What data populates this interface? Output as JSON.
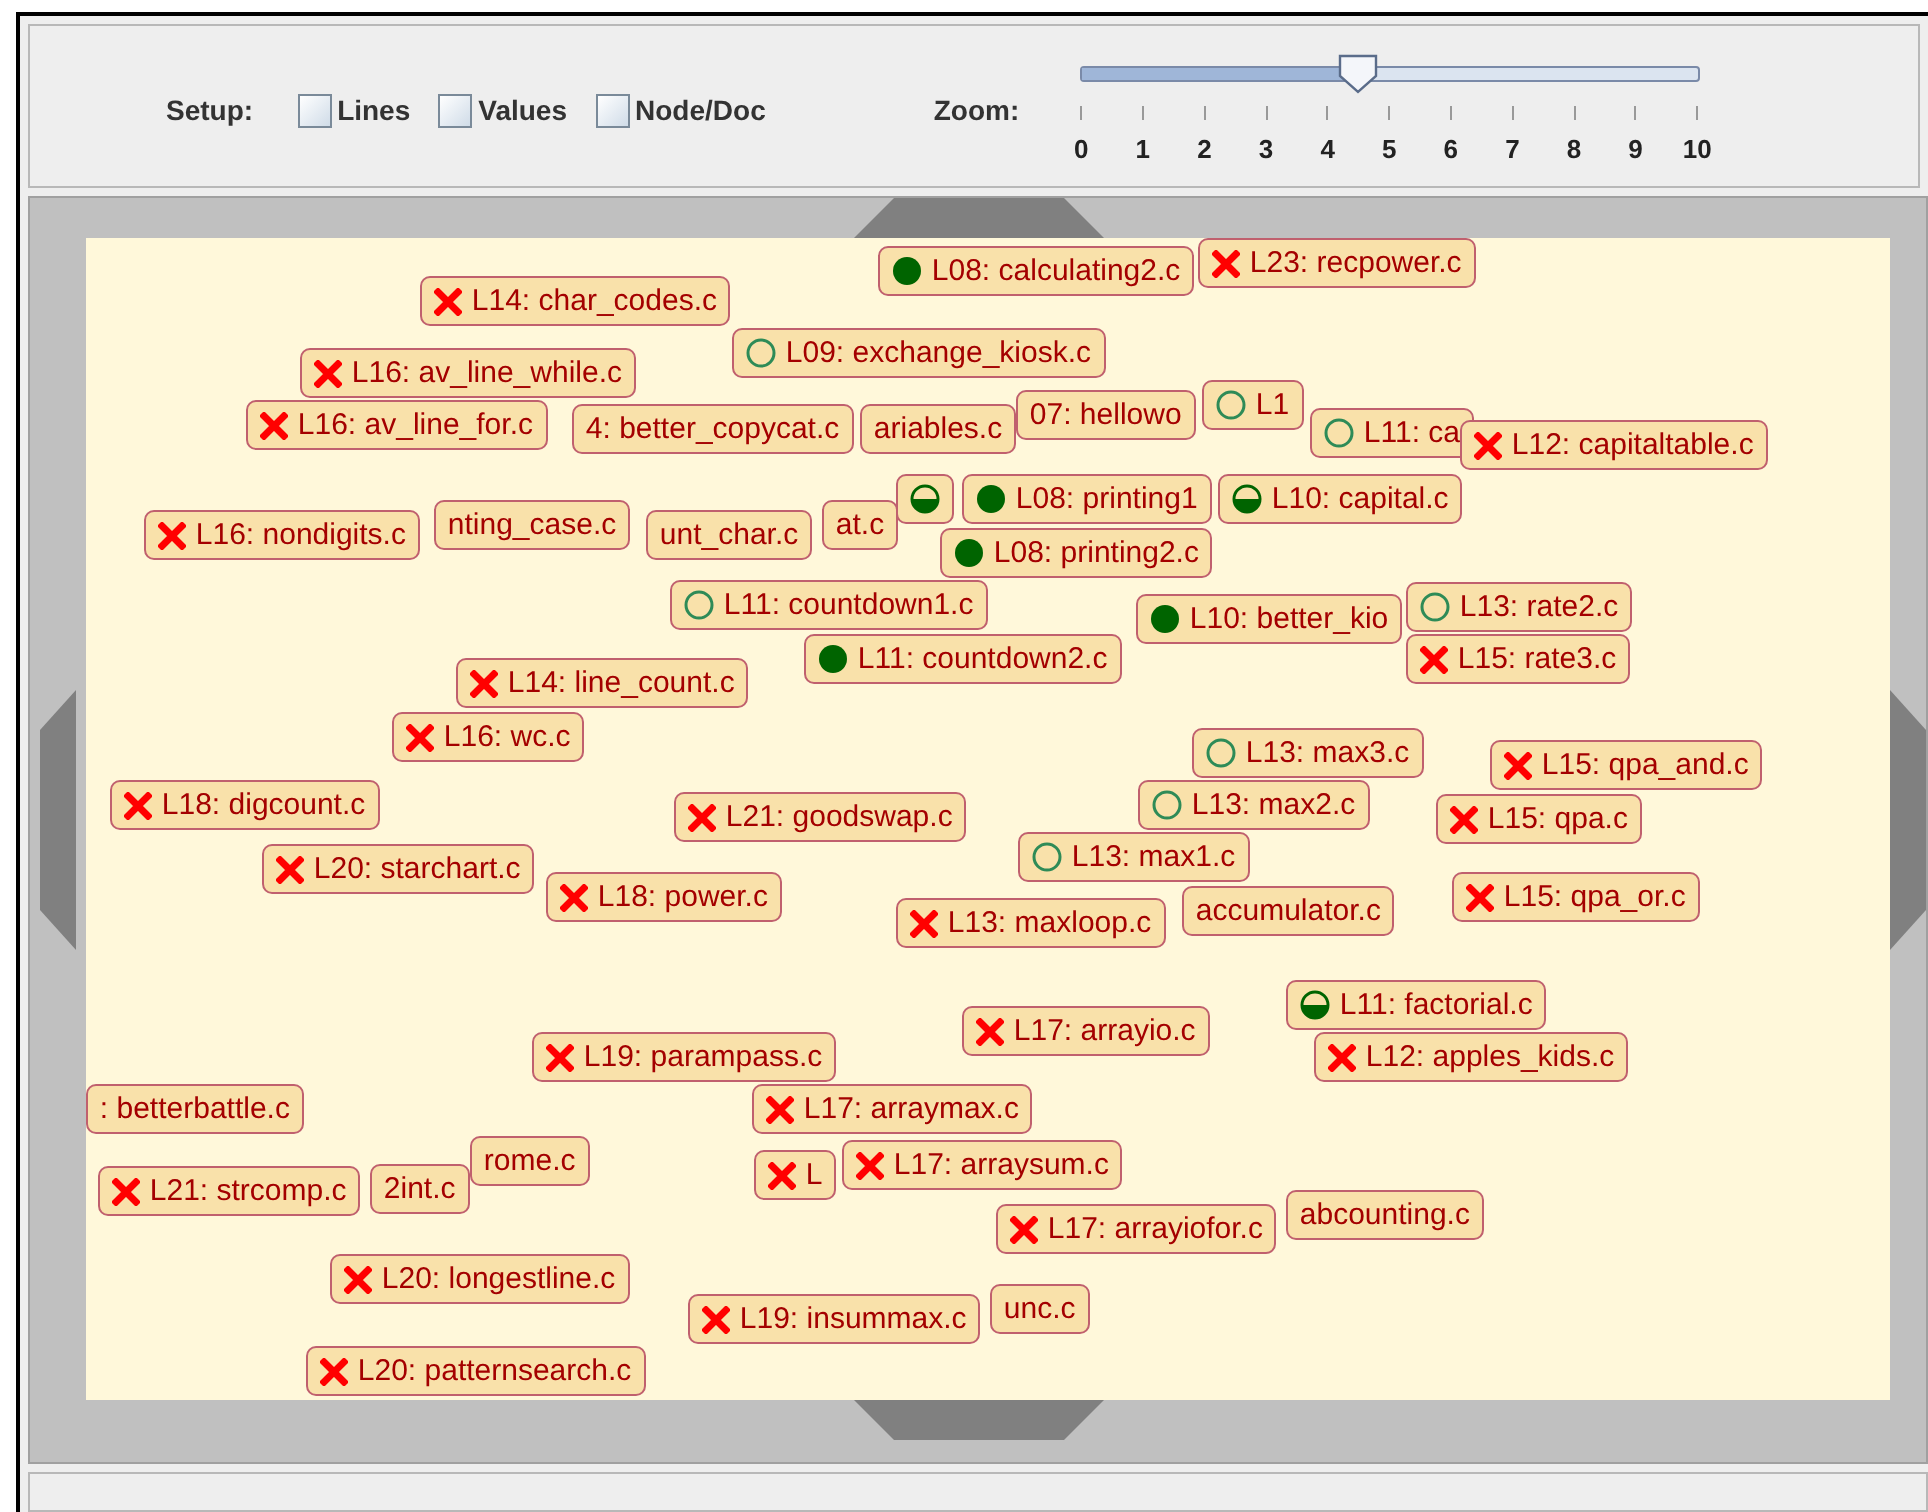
{
  "toolbar": {
    "setup_label": "Setup:",
    "options": [
      {
        "label": "Lines",
        "checked": false
      },
      {
        "label": "Values",
        "checked": false
      },
      {
        "label": "Node/Doc",
        "checked": false
      }
    ],
    "zoom_label": "Zoom:",
    "zoom": {
      "level": 0.45,
      "ticks": [
        "0",
        "1",
        "2",
        "3",
        "4",
        "5",
        "6",
        "7",
        "8",
        "9",
        "10"
      ]
    }
  },
  "nodes": [
    {
      "text": "L08: calculating2.c",
      "kind": "full"
    },
    {
      "text": "L23: recpower.c",
      "kind": "fail"
    },
    {
      "text": "L14: char_codes.c",
      "kind": "fail"
    },
    {
      "text": "L09: exchange_kiosk.c",
      "kind": "empty"
    },
    {
      "text": "07: hellowo",
      "kind": "plain"
    },
    {
      "text": "4: better_copycat.c",
      "kind": "plain"
    },
    {
      "text": "ariables.c",
      "kind": "plain"
    },
    {
      "text": "L16: av_line_while.c",
      "kind": "fail"
    },
    {
      "text": "L16: av_line_for.c",
      "kind": "fail"
    },
    {
      "text": "L1",
      "kind": "empty"
    },
    {
      "text": "L11: ca",
      "kind": "empty"
    },
    {
      "text": "L12: capitaltable.c",
      "kind": "fail"
    },
    {
      "text": "L16: nondigits.c",
      "kind": "fail"
    },
    {
      "text": "nting_case.c",
      "kind": "plain"
    },
    {
      "text": "unt_char.c",
      "kind": "plain"
    },
    {
      "text": "at.c",
      "kind": "plain"
    },
    {
      "kind": "half"
    },
    {
      "text": "L08: printing1",
      "kind": "full"
    },
    {
      "text": "L10: capital.c",
      "kind": "half"
    },
    {
      "text": "L08: printing2.c",
      "kind": "full"
    },
    {
      "text": "L11: countdown1.c",
      "kind": "empty"
    },
    {
      "text": "L10: better_kio",
      "kind": "full"
    },
    {
      "text": "L13: rate2.c",
      "kind": "empty"
    },
    {
      "text": "L15: rate3.c",
      "kind": "fail"
    },
    {
      "text": "L11: countdown2.c",
      "kind": "full"
    },
    {
      "text": "L14: line_count.c",
      "kind": "fail"
    },
    {
      "text": "L16: wc.c",
      "kind": "fail"
    },
    {
      "text": "L18: digcount.c",
      "kind": "fail"
    },
    {
      "text": "L21: goodswap.c",
      "kind": "fail"
    },
    {
      "text": "L13: max3.c",
      "kind": "empty"
    },
    {
      "text": "L15: qpa_and.c",
      "kind": "fail"
    },
    {
      "text": "L13: max1.c",
      "kind": "empty"
    },
    {
      "text": "L13: max2.c",
      "kind": "empty"
    },
    {
      "text": "L15: qpa.c",
      "kind": "fail"
    },
    {
      "text": "L18: power.c",
      "kind": "fail"
    },
    {
      "text": "L20: starchart.c",
      "kind": "fail"
    },
    {
      "text": "accumulator.c",
      "kind": "plain"
    },
    {
      "text": "L13: maxloop.c",
      "kind": "fail"
    },
    {
      "text": "L15: qpa_or.c",
      "kind": "fail"
    },
    {
      "text": "L11: factorial.c",
      "kind": "half"
    },
    {
      "text": "L12: apples_kids.c",
      "kind": "fail"
    },
    {
      "text": "L17: arrayio.c",
      "kind": "fail"
    },
    {
      "text": "L19: parampass.c",
      "kind": "fail"
    },
    {
      "text": ": betterbattle.c",
      "kind": "plain"
    },
    {
      "text": "L17: arraymax.c",
      "kind": "fail"
    },
    {
      "text": "L21: strcomp.c",
      "kind": "fail"
    },
    {
      "text": "2int.c",
      "kind": "plain"
    },
    {
      "text": "rome.c",
      "kind": "plain"
    },
    {
      "text": "L",
      "kind": "fail"
    },
    {
      "text": "L17: arraysum.c",
      "kind": "fail"
    },
    {
      "text": "abcounting.c",
      "kind": "plain"
    },
    {
      "text": "L17: arrayiofor.c",
      "kind": "fail"
    },
    {
      "text": "L20: longestline.c",
      "kind": "fail"
    },
    {
      "text": "unc.c",
      "kind": "plain"
    },
    {
      "text": "L19: insummax.c",
      "kind": "fail"
    },
    {
      "text": "L20: patternsearch.c",
      "kind": "fail"
    }
  ]
}
